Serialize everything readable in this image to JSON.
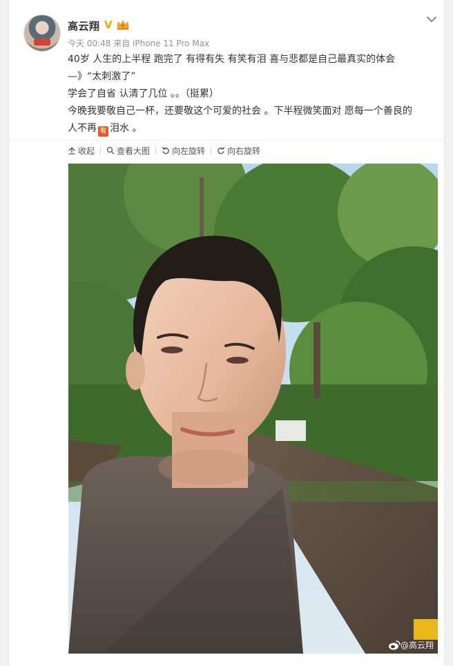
{
  "post": {
    "username": "高云翔",
    "meta": "今天 00:48 来自 iPhone 11 Pro Max",
    "lines": {
      "line1": "40岁 人生的上半程 跑完了 有得有失 有笑有泪 喜与悲都是自己最真实的体会",
      "line2": "—》“太刺激了”",
      "line3": "学会了自省 认清了几位 。。（挺累）",
      "line4": "今晚我要敬自己一杯，还要敬这个可爱的社会 。下半程微笑面对 愿每一个善良的",
      "line5_before": "人不再",
      "emoji_text": "有",
      "line5_after": "泪水 。"
    },
    "toolbar": {
      "collapse": "收起",
      "view_large": "查看大图",
      "rotate_left": "向左旋转",
      "rotate_right": "向右旋转"
    },
    "watermark": "@高云翔"
  },
  "colors": {
    "verified": "#f4a600",
    "text": "#333333",
    "meta": "#939393",
    "toolbar_text": "#555555"
  },
  "icons": [
    "chevron-down-icon",
    "verified-v-icon",
    "crown-icon",
    "collapse-icon",
    "magnifier-icon",
    "rotate-left-icon",
    "rotate-right-icon",
    "weibo-logo-icon"
  ]
}
